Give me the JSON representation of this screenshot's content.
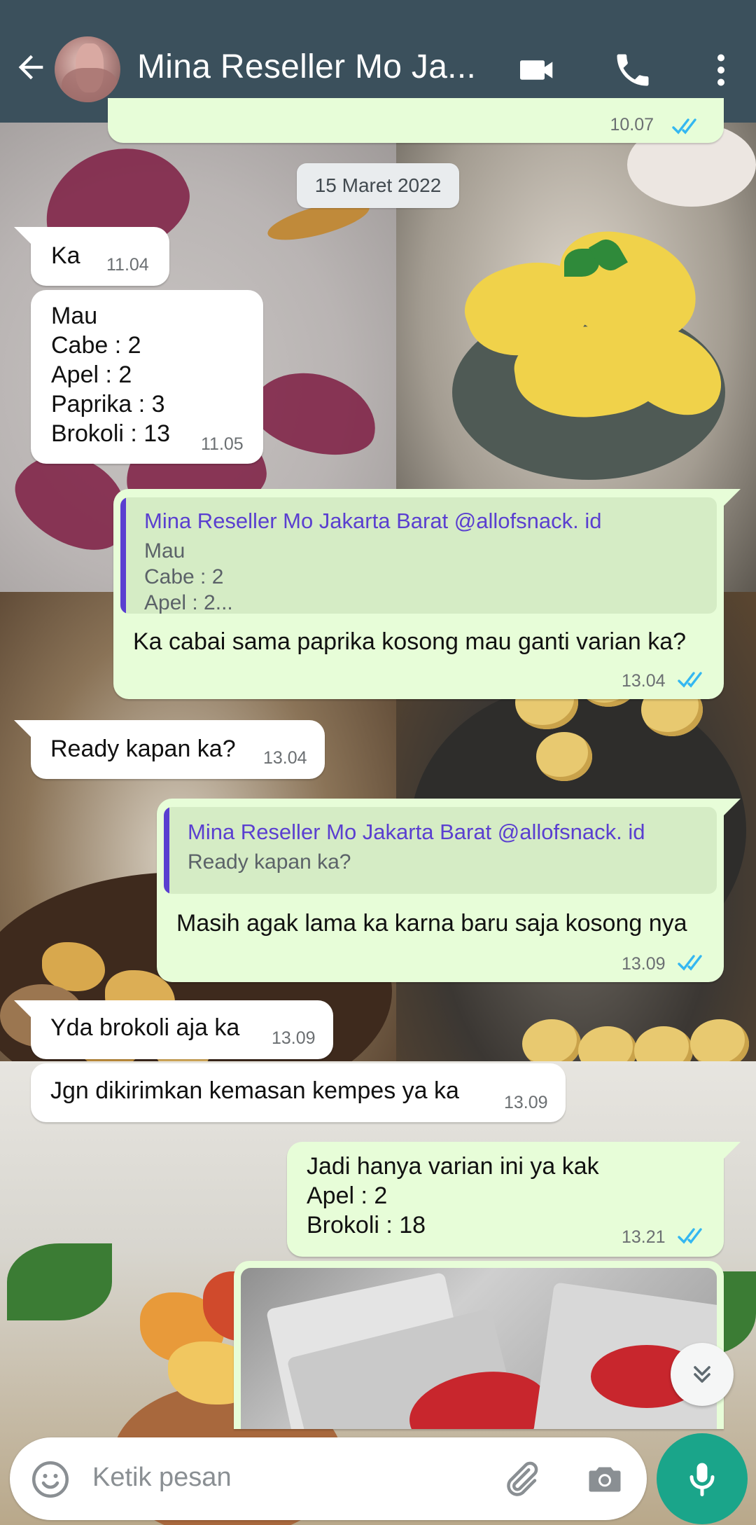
{
  "header": {
    "title": "Mina Reseller Mo Ja...",
    "back_icon": "arrow-left-icon",
    "actions": [
      "video-call-icon",
      "phone-call-icon",
      "more-vert-icon"
    ]
  },
  "date_separator": "15 Maret 2022",
  "messages": [
    {
      "direction": "out",
      "time": "10.07",
      "status": "read"
    },
    {
      "direction": "in",
      "text": "Ka",
      "time": "11.04"
    },
    {
      "direction": "in",
      "text": "Mau\nCabe : 2\nApel : 2\nPaprika : 3\nBrokoli : 13",
      "time": "11.05"
    },
    {
      "direction": "out",
      "quote": {
        "author": "Mina Reseller Mo Jakarta Barat @allofsnack. id",
        "text": "Mau\nCabe : 2\nApel : 2..."
      },
      "text": "Ka cabai sama paprika kosong mau ganti varian ka?",
      "time": "13.04",
      "status": "read"
    },
    {
      "direction": "in",
      "text": "Ready kapan ka?",
      "time": "13.04"
    },
    {
      "direction": "out",
      "quote": {
        "author": "Mina Reseller Mo Jakarta Barat @allofsnack. id",
        "text": "Ready kapan ka?"
      },
      "text": "Masih agak lama ka karna baru saja kosong nya",
      "time": "13.09",
      "status": "read"
    },
    {
      "direction": "in",
      "text": "Yda brokoli aja ka",
      "time": "13.09"
    },
    {
      "direction": "in",
      "text": "Jgn dikirimkan kemasan kempes ya ka",
      "time": "13.09"
    },
    {
      "direction": "out",
      "text": "Jadi hanya varian ini ya kak\nApel : 2\nBrokoli : 18",
      "time": "13.21",
      "status": "read"
    },
    {
      "direction": "out",
      "type": "image",
      "caption": ""
    }
  ],
  "composer": {
    "placeholder": "Ketik pesan",
    "emoji_icon": "emoji-icon",
    "attach_icon": "paperclip-icon",
    "camera_icon": "camera-icon",
    "mic_icon": "microphone-icon",
    "scroll_icon": "double-chevron-down-icon"
  },
  "colors": {
    "header": "#3b505c",
    "outgoing_bubble": "#e7fdd8",
    "incoming_bubble": "#ffffff",
    "quote_accent": "#5a3fd0",
    "read_ticks": "#34b7f1",
    "mic_button": "#1aa58a"
  }
}
